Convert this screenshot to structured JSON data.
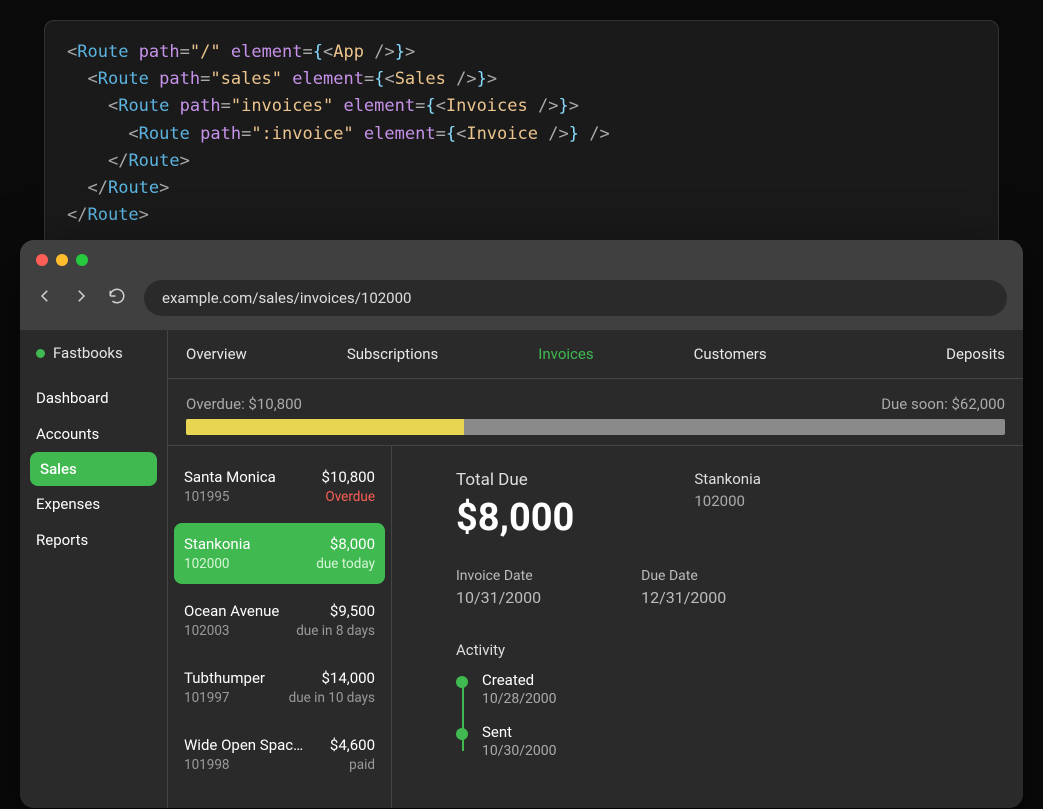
{
  "code": {
    "routes": [
      {
        "indent": 0,
        "path": "/",
        "component": "App",
        "selfClosing": false
      },
      {
        "indent": 1,
        "path": "sales",
        "component": "Sales",
        "selfClosing": false
      },
      {
        "indent": 2,
        "path": "invoices",
        "component": "Invoices",
        "selfClosing": false
      },
      {
        "indent": 3,
        "path": ":invoice",
        "component": "Invoice",
        "selfClosing": true
      }
    ]
  },
  "browser": {
    "url": "example.com/sales/invoices/102000"
  },
  "app": {
    "brand": "Fastbooks",
    "sidebar": [
      {
        "label": "Dashboard",
        "active": false
      },
      {
        "label": "Accounts",
        "active": false
      },
      {
        "label": "Sales",
        "active": true
      },
      {
        "label": "Expenses",
        "active": false
      },
      {
        "label": "Reports",
        "active": false
      }
    ],
    "tabs": [
      {
        "label": "Overview",
        "active": false
      },
      {
        "label": "Subscriptions",
        "active": false
      },
      {
        "label": "Invoices",
        "active": true
      },
      {
        "label": "Customers",
        "active": false
      },
      {
        "label": "Deposits",
        "active": false
      }
    ],
    "summary": {
      "overdue_label": "Overdue: $10,800",
      "due_soon_label": "Due soon: $62,000",
      "overdue_bar_pct": 34
    },
    "invoices": [
      {
        "name": "Santa Monica",
        "amount": "$10,800",
        "id": "101995",
        "status": "Overdue",
        "overdue": true,
        "selected": false
      },
      {
        "name": "Stankonia",
        "amount": "$8,000",
        "id": "102000",
        "status": "due today",
        "overdue": false,
        "selected": true
      },
      {
        "name": "Ocean Avenue",
        "amount": "$9,500",
        "id": "102003",
        "status": "due in 8 days",
        "overdue": false,
        "selected": false
      },
      {
        "name": "Tubthumper",
        "amount": "$14,000",
        "id": "101997",
        "status": "due in 10 days",
        "overdue": false,
        "selected": false
      },
      {
        "name": "Wide Open Spaces",
        "amount": "$4,600",
        "id": "101998",
        "status": "paid",
        "overdue": false,
        "selected": false
      }
    ],
    "detail": {
      "total_label": "Total Due",
      "total_amount": "$8,000",
      "client_name": "Stankonia",
      "client_id": "102000",
      "invoice_date_label": "Invoice Date",
      "invoice_date": "10/31/2000",
      "due_date_label": "Due Date",
      "due_date": "12/31/2000",
      "activity_label": "Activity",
      "activity": [
        {
          "title": "Created",
          "date": "10/28/2000"
        },
        {
          "title": "Sent",
          "date": "10/30/2000"
        }
      ]
    }
  }
}
